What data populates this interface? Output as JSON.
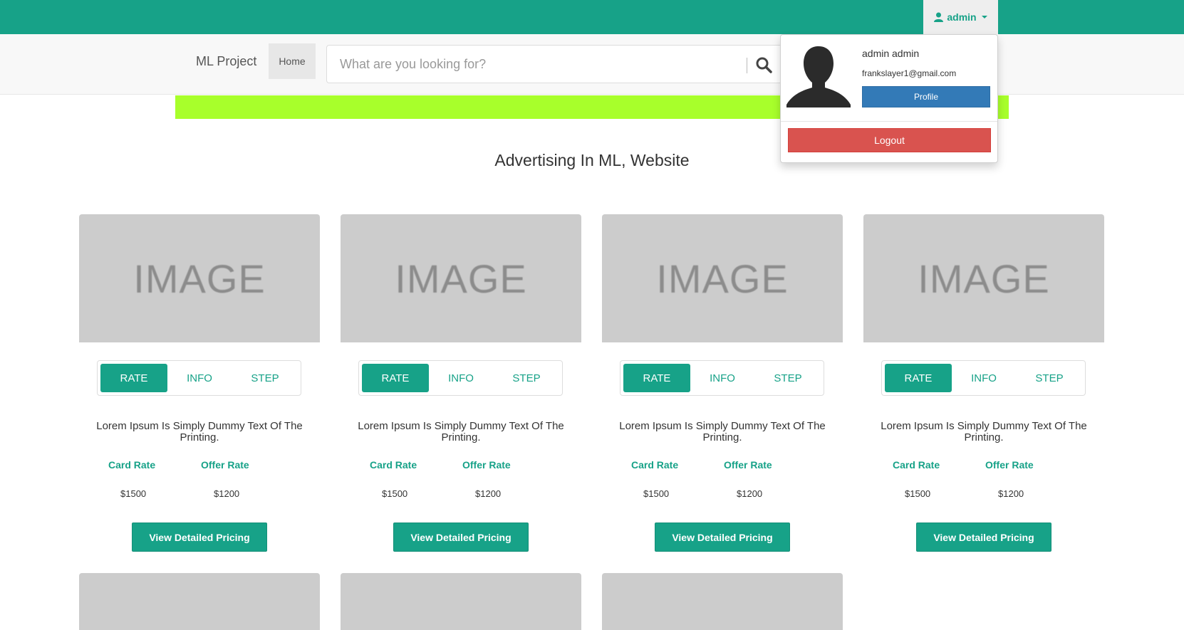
{
  "header": {
    "user_label": "admin",
    "brand": "ML Project",
    "home_label": "Home",
    "search_placeholder": "What are you looking for?",
    "colors": {
      "primary": "#17a288",
      "banner": "#a8ff2b"
    }
  },
  "user_menu": {
    "name": "admin admin",
    "email": "frankslayer1@gmail.com",
    "profile_label": "Profile",
    "logout_label": "Logout"
  },
  "section": {
    "title": "Advertising In ML, Website"
  },
  "card_template": {
    "image_text": "IMAGE",
    "tabs": [
      "RATE",
      "INFO",
      "STEP"
    ],
    "description": "Lorem Ipsum Is Simply Dummy Text Of The Printing.",
    "card_rate_label": "Card Rate",
    "offer_rate_label": "Offer Rate",
    "card_rate_value": "$1500",
    "offer_rate_value": "$1200",
    "button_label": "View Detailed Pricing"
  },
  "cards": [
    {
      "image_text": "IMAGE",
      "tabs": [
        "RATE",
        "INFO",
        "STEP"
      ],
      "description": "Lorem Ipsum Is Simply Dummy Text Of The Printing.",
      "card_rate_label": "Card Rate",
      "offer_rate_label": "Offer Rate",
      "card_rate": "$1500",
      "offer_rate": "$1200",
      "button_label": "View Detailed Pricing"
    },
    {
      "image_text": "IMAGE",
      "tabs": [
        "RATE",
        "INFO",
        "STEP"
      ],
      "description": "Lorem Ipsum Is Simply Dummy Text Of The Printing.",
      "card_rate_label": "Card Rate",
      "offer_rate_label": "Offer Rate",
      "card_rate": "$1500",
      "offer_rate": "$1200",
      "button_label": "View Detailed Pricing"
    },
    {
      "image_text": "IMAGE",
      "tabs": [
        "RATE",
        "INFO",
        "STEP"
      ],
      "description": "Lorem Ipsum Is Simply Dummy Text Of The Printing.",
      "card_rate_label": "Card Rate",
      "offer_rate_label": "Offer Rate",
      "card_rate": "$1500",
      "offer_rate": "$1200",
      "button_label": "View Detailed Pricing"
    },
    {
      "image_text": "IMAGE",
      "tabs": [
        "RATE",
        "INFO",
        "STEP"
      ],
      "description": "Lorem Ipsum Is Simply Dummy Text Of The Printing.",
      "card_rate_label": "Card Rate",
      "offer_rate_label": "Offer Rate",
      "card_rate": "$1500",
      "offer_rate": "$1200",
      "button_label": "View Detailed Pricing"
    }
  ]
}
